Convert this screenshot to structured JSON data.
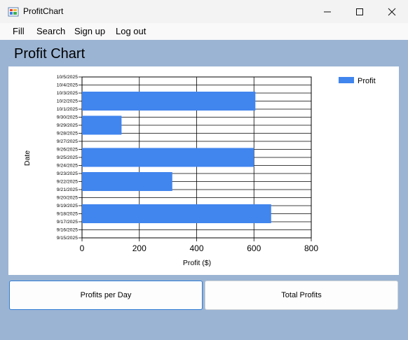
{
  "window": {
    "title": "ProfitChart",
    "icon": "windows-forms-app-icon",
    "controls": [
      "minimize-icon",
      "maximize-icon",
      "close-icon"
    ]
  },
  "menu": {
    "items": [
      "Fill",
      "Search",
      "Sign up",
      "Log out"
    ]
  },
  "page": {
    "title": "Profit Chart"
  },
  "buttons": {
    "profits_per_day": "Profits per Day",
    "total_profits": "Total Profits"
  },
  "colors": {
    "bar": "#4185ee",
    "background": "#9bb4d3"
  },
  "chart_data": {
    "type": "bar",
    "orientation": "horizontal",
    "title": "",
    "xlabel": "Profit ($)",
    "ylabel": "Date",
    "xlim": [
      0,
      800
    ],
    "xticks": [
      0,
      200,
      400,
      600,
      800
    ],
    "grid": true,
    "legend": {
      "position": "top-right",
      "entries": [
        "Profit"
      ]
    },
    "categories": [
      "9/15/2025",
      "9/16/2025",
      "9/17/2025",
      "9/18/2025",
      "9/19/2025",
      "9/20/2025",
      "9/21/2025",
      "9/22/2025",
      "9/23/2025",
      "9/24/2025",
      "9/25/2025",
      "9/26/2025",
      "9/27/2025",
      "9/28/2025",
      "9/29/2025",
      "9/30/2025",
      "10/1/2025",
      "10/2/2025",
      "10/3/2025",
      "10/4/2025",
      "10/5/2025"
    ],
    "series": [
      {
        "name": "Profit",
        "bars": [
          {
            "date": "9/18/2025",
            "value": 660
          },
          {
            "date": "9/22/2025",
            "value": 315
          },
          {
            "date": "9/25/2025",
            "value": 600
          },
          {
            "date": "9/29/2025",
            "value": 138
          },
          {
            "date": "10/2/2025",
            "value": 605
          }
        ]
      }
    ]
  }
}
